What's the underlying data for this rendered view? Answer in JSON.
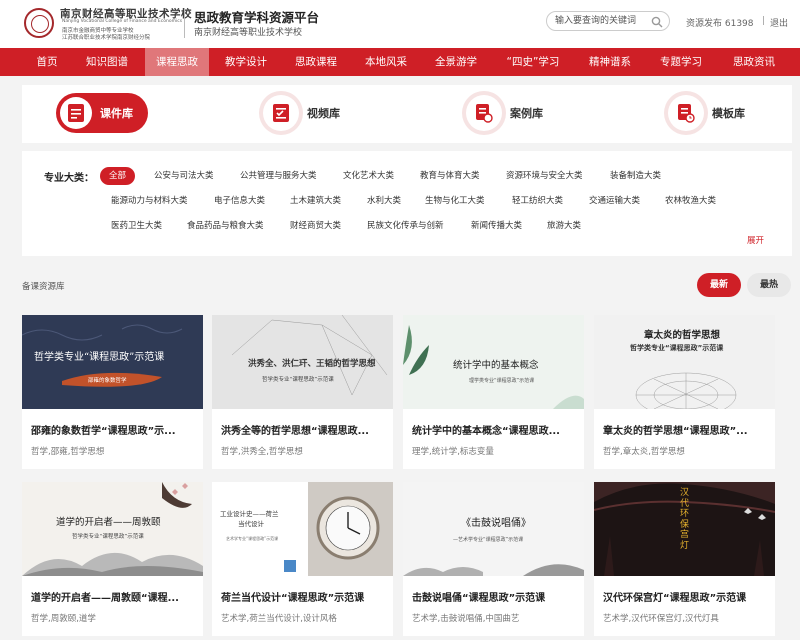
{
  "header": {
    "school_name": "南京财经高等职业技术学校",
    "school_en": "Nanjing Vocational College of Finance and Economics",
    "school_sub1": "南京市金融商贸中等专业学校",
    "school_sub2": "江苏联合职业技术学院南京财经分院",
    "platform_title": "思政教育学科资源平台",
    "platform_sub": "南京财经高等职业技术学校",
    "search_placeholder": "输入要查询的关键词",
    "resource_stat": "资源发布  61398",
    "separator": "|",
    "logout": "退出"
  },
  "nav": {
    "items": [
      {
        "label": "首页"
      },
      {
        "label": "知识图谱"
      },
      {
        "label": "课程思政"
      },
      {
        "label": "教学设计"
      },
      {
        "label": "思政课程"
      },
      {
        "label": "本地风采"
      },
      {
        "label": "全景游学"
      },
      {
        "label": "“四史”学习"
      },
      {
        "label": "精神谱系"
      },
      {
        "label": "专题学习"
      },
      {
        "label": "思政资讯"
      }
    ],
    "active_index": 2
  },
  "categories": {
    "tabs": [
      {
        "label": "课件库",
        "icon": "courseware-icon"
      },
      {
        "label": "视频库",
        "icon": "video-icon"
      },
      {
        "label": "案例库",
        "icon": "case-icon"
      },
      {
        "label": "模板库",
        "icon": "template-icon"
      }
    ],
    "active_index": 0
  },
  "filters": {
    "label": "专业大类：",
    "expand": "展开",
    "rows": [
      [
        "全部",
        "公安与司法大类",
        "公共管理与服务大类",
        "文化艺术大类",
        "教育与体育大类",
        "资源环境与安全大类",
        "装备制造大类"
      ],
      [
        "能源动力与材料大类",
        "电子信息大类",
        "土木建筑大类",
        "水利大类",
        "生物与化工大类",
        "轻工纺织大类",
        "交通运输大类",
        "农林牧渔大类"
      ],
      [
        "医药卫生大类",
        "食品药品与粮食大类",
        "财经商贸大类",
        "民族文化传承与创新",
        "新闻传播大类",
        "旅游大类"
      ]
    ]
  },
  "list": {
    "section_label": "备课资源库",
    "sort_new": "最新",
    "sort_hot": "最热"
  },
  "cards": [
    {
      "title": "邵雍的象数哲学“课程思政”示...",
      "tags": "哲学,邵雍,哲学思想",
      "thumb_main": "哲学类专业“课程思政”示范课",
      "thumb_sub": "邵雍的象数哲学"
    },
    {
      "title": "洪秀全等的哲学思想“课程思政...",
      "tags": "哲学,洪秀全,哲学思想",
      "thumb_main": "洪秀全、洪仁玕、王韬的哲学思想",
      "thumb_sub": "哲学类专业“课程思政”示范课"
    },
    {
      "title": "统计学中的基本概念“课程思政...",
      "tags": "理学,统计学,标志变量",
      "thumb_main": "统计学中的基本概念",
      "thumb_sub": "理学类专业“课程思政”示范课"
    },
    {
      "title": "章太炎的哲学思想“课程思政”...",
      "tags": "哲学,章太炎,哲学思想",
      "thumb_main": "章太炎的哲学思想",
      "thumb_sub": "哲学类专业“课程思政”示范课"
    },
    {
      "title": "道学的开启者——周敦颐“课程...",
      "tags": "哲学,周敦颐,道学",
      "thumb_main": "道学的开启者——周敦颐",
      "thumb_sub": "哲学类专业“课程思政”示范课"
    },
    {
      "title": "荷兰当代设计“课程思政”示范课",
      "tags": "艺术学,荷兰当代设计,设计风格",
      "thumb_main": "工业设计史——荷兰",
      "thumb_main2": "当代设计",
      "thumb_sub": "艺术学专业“课程思政”示范课"
    },
    {
      "title": "击鼓说唱俑“课程思政”示范课",
      "tags": "艺术学,击鼓说唱俑,中国曲艺",
      "thumb_main": "《击鼓说唱俑》",
      "thumb_sub": "—艺术学专业“课程思政”示范课"
    },
    {
      "title": "汉代环保宫灯“课程思政”示范课",
      "tags": "艺术学,汉代环保宫灯,汉代灯具",
      "thumb_main": "汉代环保宫灯"
    }
  ],
  "colors": {
    "brand_red": "#cf1f26",
    "nav_active": "#e0777a"
  }
}
